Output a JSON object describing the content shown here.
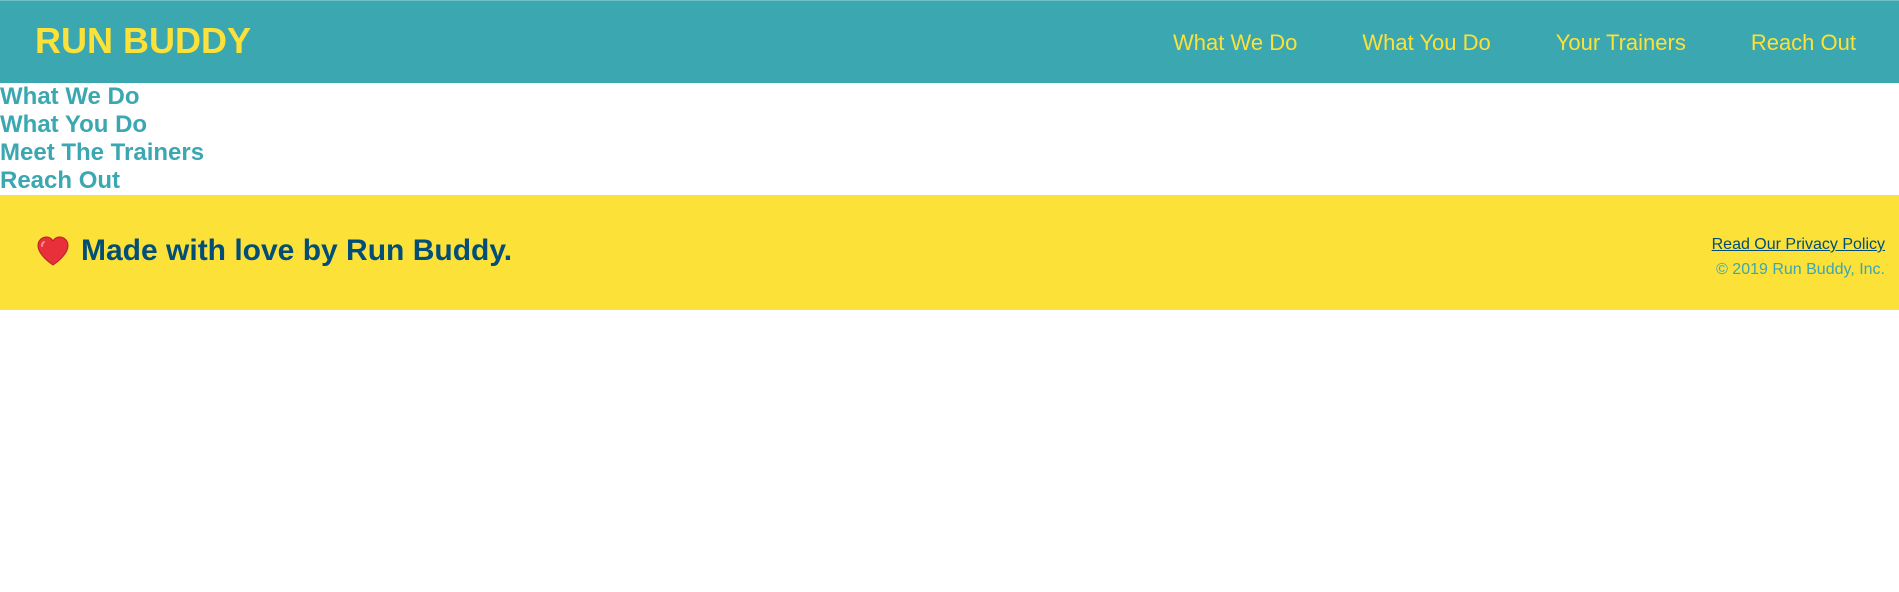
{
  "header": {
    "brand": "RUN BUDDY",
    "nav": [
      {
        "label": "What We Do"
      },
      {
        "label": "What You Do"
      },
      {
        "label": "Your Trainers"
      },
      {
        "label": "Reach Out"
      }
    ]
  },
  "sections": [
    {
      "title": "What We Do"
    },
    {
      "title": "What You Do"
    },
    {
      "title": "Meet The Trainers"
    },
    {
      "title": "Reach Out"
    }
  ],
  "footer": {
    "heart_icon": "heart-icon",
    "love_text": "Made with love by Run Buddy.",
    "privacy_link": "Read Our Privacy Policy",
    "copyright": "© 2019 Run Buddy, Inc."
  },
  "colors": {
    "primary_teal": "#3ba7b1",
    "accent_yellow": "#fce138",
    "dark_blue": "#024e76",
    "heart_red": "#e8303b"
  }
}
